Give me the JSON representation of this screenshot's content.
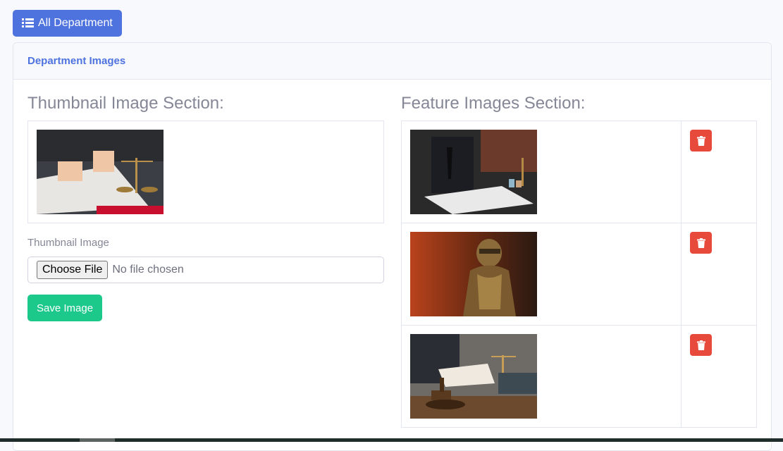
{
  "toolbar": {
    "all_department_label": "All Department",
    "icon": "list-icon"
  },
  "card": {
    "header_title": "Department Images"
  },
  "thumbnail_section": {
    "title": "Thumbnail Image Section:",
    "image_alt": "thumbnail-image",
    "field_label": "Thumbnail Image",
    "file_button_label": "Choose File",
    "file_status": "No file chosen",
    "save_label": "Save Image"
  },
  "feature_section": {
    "title": "Feature Images Section:",
    "images": [
      {
        "alt": "feature-image-1",
        "delete_icon": "trash-icon"
      },
      {
        "alt": "feature-image-2",
        "delete_icon": "trash-icon"
      },
      {
        "alt": "feature-image-3",
        "delete_icon": "trash-icon"
      }
    ]
  },
  "colors": {
    "primary": "#4e73df",
    "success": "#1cc88a",
    "danger": "#e74a3b",
    "text_muted": "#858796"
  }
}
